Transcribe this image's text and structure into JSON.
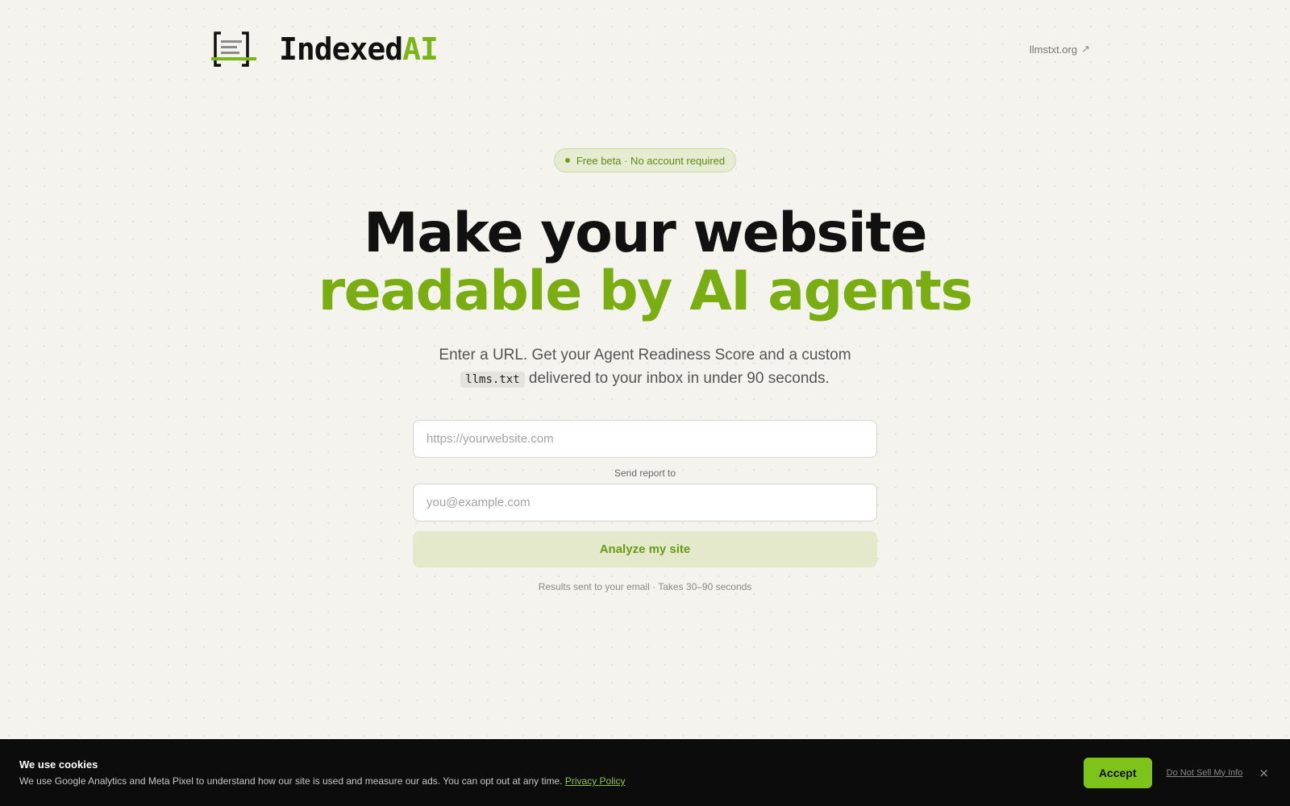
{
  "header": {
    "brand_main": "Indexed",
    "brand_accent": "AI",
    "ext_link": "llmstxt.org",
    "ext_link_icon": "external-arrow-icon"
  },
  "hero": {
    "badge": "Free beta · No account required",
    "title_line1": "Make your website",
    "title_line2": "readable by AI agents",
    "sub_part1": "Enter a URL. Get your Agent Readiness Score and a custom",
    "sub_code": "llms.txt",
    "sub_part2": "delivered to your inbox in under 90 seconds."
  },
  "form": {
    "url_placeholder": "https://yourwebsite.com",
    "email_label": "Send report to",
    "email_placeholder": "you@example.com",
    "submit_label": "Analyze my site",
    "note": "Results sent to your email · Takes 30–90 seconds"
  },
  "cookie": {
    "title": "We use cookies",
    "text": "We use Google Analytics and Meta Pixel to understand how our site is used and measure our ads. You can opt out at any time.",
    "privacy_link": "Privacy Policy",
    "accept_label": "Accept",
    "dnsmi_label": "Do Not Sell My Info",
    "close_glyph": "×"
  },
  "colors": {
    "accent": "#7cb518",
    "background": "#f4f3ee",
    "cookie_bg": "#0c0c0c"
  }
}
